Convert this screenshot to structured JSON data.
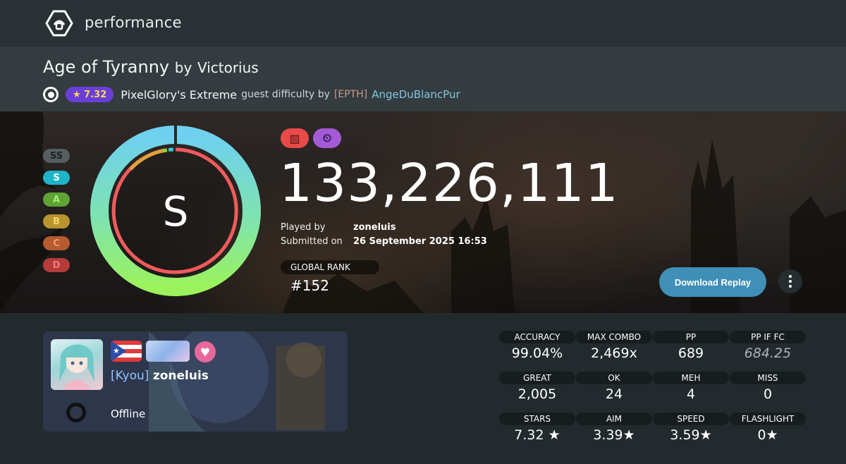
{
  "app": {
    "title": "performance"
  },
  "beatmap": {
    "title": "Age of Tyranny",
    "by": "by",
    "artist": "Victorius",
    "star_rating": "★ 7.32",
    "difficulty": "PixelGlory's Extreme",
    "guest_text": "guest difficulty by",
    "mapper_tag": "[EPTH]",
    "mapper": "AngeDuBlancPur"
  },
  "grades": [
    {
      "label": "SS",
      "color": "#555f63",
      "text": "#222"
    },
    {
      "label": "S",
      "color": "#1fb5c9",
      "text": "#fff"
    },
    {
      "label": "A",
      "color": "#5ea333",
      "text": "#9ef07a"
    },
    {
      "label": "B",
      "color": "#b8942e",
      "text": "#f5d36a"
    },
    {
      "label": "C",
      "color": "#b55b2f",
      "text": "#f09a6b"
    },
    {
      "label": "D",
      "color": "#b53b3b",
      "text": "#f07a7a"
    }
  ],
  "grade": {
    "rank": "S",
    "accuracy": 0.9904
  },
  "mods": [
    {
      "name": "hard-rock",
      "color": "#e84a4a",
      "symbol": "▨"
    },
    {
      "name": "double-time",
      "color": "#a45ad6",
      "symbol": "⏲"
    }
  ],
  "score": {
    "total": "133,226,111",
    "played_by_label": "Played by",
    "player": "zoneluis",
    "submitted_label": "Submitted on",
    "submitted": "26 September 2025 16:53",
    "global_rank_label": "GLOBAL RANK",
    "global_rank": "#152"
  },
  "actions": {
    "download": "Download Replay"
  },
  "user": {
    "clan": "[Kyou]",
    "name": "zoneluis",
    "status": "Offline",
    "heart": "♥",
    "flag_star": "★"
  },
  "stats": [
    {
      "label": "ACCURACY",
      "value": "99.04%"
    },
    {
      "label": "MAX COMBO",
      "value": "2,469x"
    },
    {
      "label": "PP",
      "value": "689"
    },
    {
      "label": "PP IF FC",
      "value": "684.25",
      "dim": true
    },
    {
      "label": "GREAT",
      "value": "2,005"
    },
    {
      "label": "OK",
      "value": "24"
    },
    {
      "label": "MEH",
      "value": "4"
    },
    {
      "label": "MISS",
      "value": "0"
    },
    {
      "label": "STARS",
      "value": "7.32 ★"
    },
    {
      "label": "AIM",
      "value": "3.39★"
    },
    {
      "label": "SPEED",
      "value": "3.59★"
    },
    {
      "label": "FLASHLIGHT",
      "value": "0★"
    }
  ],
  "colors": {
    "accent": "#3f8fb6",
    "star_badge": "#6a3fd8"
  }
}
